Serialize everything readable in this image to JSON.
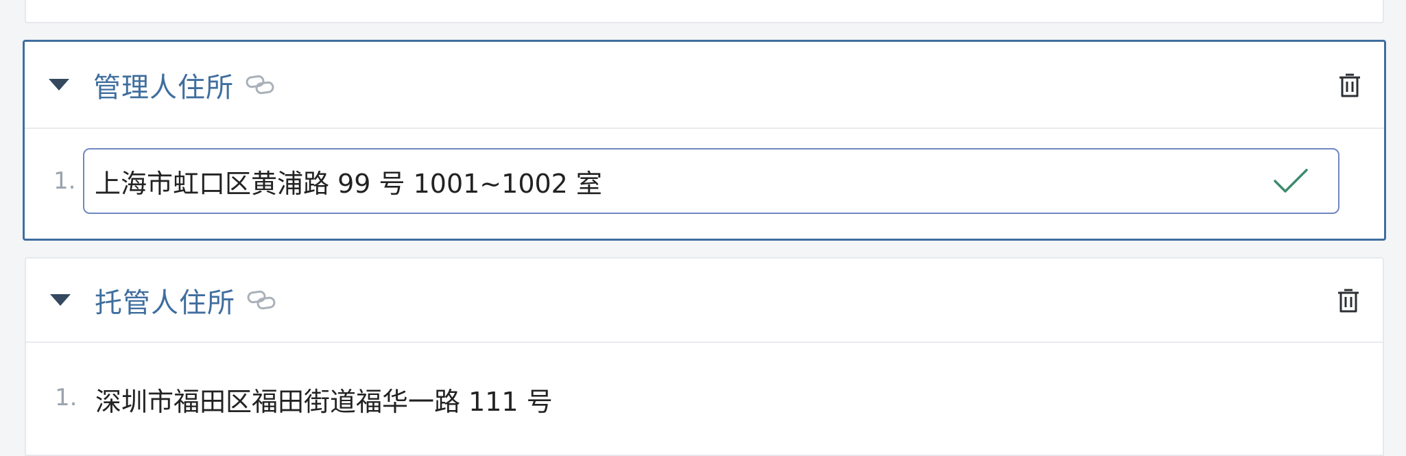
{
  "sections": [
    {
      "title": "管理人住所",
      "items": [
        {
          "index": "1.",
          "value": "上海市虹口区黄浦路 99 号 1001~1002 室"
        }
      ]
    },
    {
      "title": "托管人住所",
      "items": [
        {
          "index": "1.",
          "value": "深圳市福田区福田街道福华一路 111 号"
        }
      ]
    }
  ],
  "colors": {
    "title": "#3f6e9e",
    "active_border": "#3f6e9e",
    "input_border": "#6f86c1",
    "check": "#3d8a6d"
  },
  "icons": [
    "caret-down-icon",
    "link-icon",
    "trash-icon",
    "check-icon"
  ]
}
